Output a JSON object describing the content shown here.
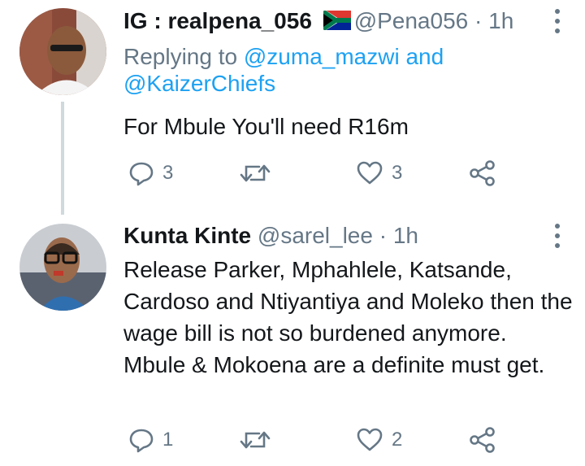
{
  "tweets": [
    {
      "display_name": "IG : realpena_056",
      "flag_icon": "south-africa-flag",
      "handle": "@Pena056",
      "separator": "·",
      "time": "1h",
      "replying_prefix": "Replying to",
      "replying_to_1": "@zuma_mazwi",
      "replying_and": "and",
      "replying_to_2": "@KaizerChiefs",
      "text": "For Mbule You'll need R16m",
      "reply_count": "3",
      "retweet_count": "",
      "like_count": "3"
    },
    {
      "display_name": "Kunta Kinte",
      "handle": "@sarel_lee",
      "separator": "·",
      "time": "1h",
      "text": "Release Parker, Mphahlele, Katsande, Cardoso and Ntiyantiya and Moleko then the wage bill is not so burdened anymore. Mbule & Mokoena are a definite must get.",
      "reply_count": "1",
      "retweet_count": "",
      "like_count": "2"
    }
  ],
  "colors": {
    "secondary": "#657786",
    "link": "#1da1f2",
    "thread_line": "#cfd9de"
  }
}
